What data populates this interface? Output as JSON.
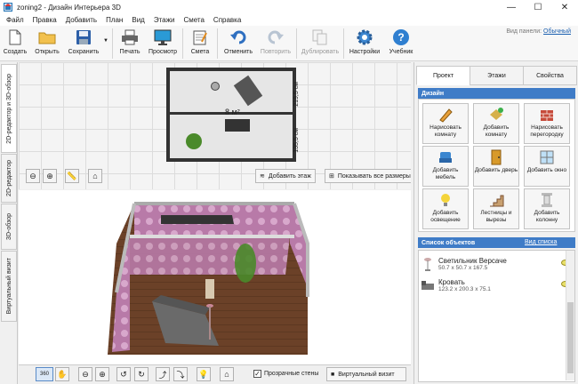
{
  "window": {
    "title": "zoning2 - Дизайн Интерьера 3D",
    "minimize": "—",
    "maximize": "☐",
    "close": "✕"
  },
  "menu": [
    "Файл",
    "Правка",
    "Добавить",
    "План",
    "Вид",
    "Этажи",
    "Смета",
    "Справка"
  ],
  "toolbar": {
    "create": "Создать",
    "open": "Открыть",
    "save": "Сохранить",
    "print": "Печать",
    "preview": "Просмотр",
    "estimate": "Смета",
    "undo": "Отменить",
    "redo": "Повторить",
    "duplicate": "Дублировать",
    "settings": "Настройки",
    "tutorial": "Учебник"
  },
  "panel_view": {
    "label": "Вид панели:",
    "value": "Обычный"
  },
  "left_tabs": [
    "2D-редактор и 3D-обзор",
    "2D-редактор",
    "3D-обзор",
    "Виртуальный визит"
  ],
  "plan": {
    "dim_top": "219,5 см",
    "dim_bottom": "135,5 см",
    "area": "8 м²",
    "add_floor": "Добавить этаж",
    "show_sizes": "Показывать все размеры"
  },
  "view3d": {
    "transparent_walls": "Прозрачные стены",
    "transparent_checked": true,
    "virtual_visit": "Виртуальный визит",
    "rotate360": "360"
  },
  "right_tabs": {
    "project": "Проект",
    "floors": "Этажи",
    "properties": "Свойства"
  },
  "design": {
    "header": "Дизайн",
    "items": [
      {
        "label": "Нарисовать комнату",
        "icon": "draw-room-icon"
      },
      {
        "label": "Добавить комнату",
        "icon": "add-room-icon"
      },
      {
        "label": "Нарисовать перегородку",
        "icon": "partition-icon"
      },
      {
        "label": "Добавить мебель",
        "icon": "furniture-icon"
      },
      {
        "label": "Добавить дверь",
        "icon": "door-icon"
      },
      {
        "label": "Добавить окно",
        "icon": "window-icon"
      },
      {
        "label": "Добавить освещение",
        "icon": "lamp-icon"
      },
      {
        "label": "Лестницы и вырезы",
        "icon": "stairs-icon"
      },
      {
        "label": "Добавить колонну",
        "icon": "column-icon"
      }
    ]
  },
  "objects": {
    "header": "Список объектов",
    "view_list": "Вид списка",
    "items": [
      {
        "name": "Светильник Версаче",
        "size": "50.7 x 50.7 x 167.5",
        "icon": "floor-lamp-icon"
      },
      {
        "name": "Кровать",
        "size": "123.2 x 200.3 x 75.1",
        "icon": "bed-icon"
      }
    ]
  },
  "colors": {
    "accent": "#3f7cc7",
    "wallpaper": "#b87aa8",
    "floor": "#6b4128"
  }
}
